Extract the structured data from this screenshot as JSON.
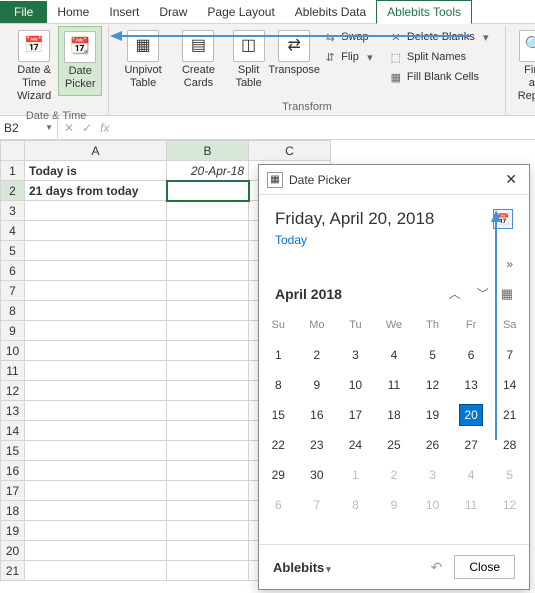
{
  "tabs": {
    "file": "File",
    "home": "Home",
    "insert": "Insert",
    "draw": "Draw",
    "page_layout": "Page Layout",
    "ablebits_data": "Ablebits Data",
    "ablebits_tools": "Ablebits Tools"
  },
  "ribbon": {
    "date_time_wizard": "Date & Time Wizard",
    "date_picker": "Date Picker",
    "unpivot_table": "Unpivot Table",
    "create_cards": "Create Cards",
    "split_table": "Split Table",
    "transpose": "Transpose",
    "swap": "Swap",
    "flip": "Flip",
    "delete_blanks": "Delete Blanks",
    "split_names": "Split Names",
    "fill_blank_cells": "Fill Blank Cells",
    "find_replace": "Find an Replac",
    "group_datetime": "Date & Time",
    "group_transform": "Transform"
  },
  "name_box": "B2",
  "cells": {
    "a1": "Today is",
    "b1": "20-Apr-18",
    "a2": "21 days from today"
  },
  "picker": {
    "title": "Date Picker",
    "selected_date": "Friday, April 20, 2018",
    "today": "Today",
    "month": "April 2018",
    "dow": [
      "Su",
      "Mo",
      "Tu",
      "We",
      "Th",
      "Fr",
      "Sa"
    ],
    "weeks": [
      [
        {
          "d": 1
        },
        {
          "d": 2
        },
        {
          "d": 3
        },
        {
          "d": 4
        },
        {
          "d": 5
        },
        {
          "d": 6
        },
        {
          "d": 7
        }
      ],
      [
        {
          "d": 8
        },
        {
          "d": 9
        },
        {
          "d": 10
        },
        {
          "d": 11
        },
        {
          "d": 12
        },
        {
          "d": 13
        },
        {
          "d": 14
        }
      ],
      [
        {
          "d": 15
        },
        {
          "d": 16
        },
        {
          "d": 17
        },
        {
          "d": 18
        },
        {
          "d": 19
        },
        {
          "d": 20,
          "sel": true
        },
        {
          "d": 21
        }
      ],
      [
        {
          "d": 22
        },
        {
          "d": 23
        },
        {
          "d": 24
        },
        {
          "d": 25
        },
        {
          "d": 26
        },
        {
          "d": 27
        },
        {
          "d": 28
        }
      ],
      [
        {
          "d": 29
        },
        {
          "d": 30
        },
        {
          "d": 1,
          "o": true
        },
        {
          "d": 2,
          "o": true
        },
        {
          "d": 3,
          "o": true
        },
        {
          "d": 4,
          "o": true
        },
        {
          "d": 5,
          "o": true
        }
      ],
      [
        {
          "d": 6,
          "o": true
        },
        {
          "d": 7,
          "o": true
        },
        {
          "d": 8,
          "o": true
        },
        {
          "d": 9,
          "o": true
        },
        {
          "d": 10,
          "o": true
        },
        {
          "d": 11,
          "o": true
        },
        {
          "d": 12,
          "o": true
        }
      ]
    ],
    "brand": "Ablebits",
    "close": "Close"
  }
}
